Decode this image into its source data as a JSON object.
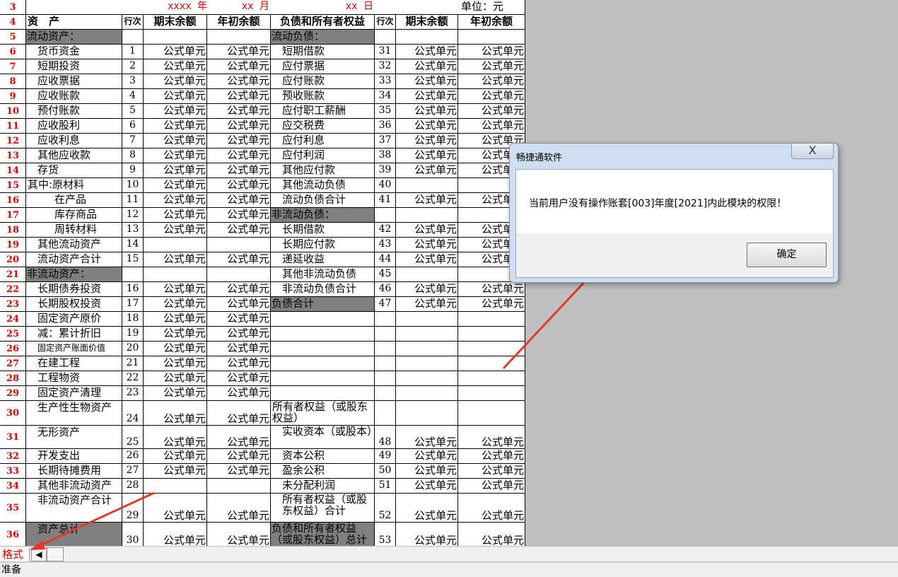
{
  "header": {
    "year": "xxxx 年",
    "month": "xx 月",
    "day": "xx 日",
    "unit": "单位：元"
  },
  "columns": {
    "assets": "资　产",
    "line_no": "行次",
    "end_balance": "期末余额",
    "begin_balance": "年初余额",
    "liab_equity": "负债和所有者权益",
    "line_no2": "行次",
    "end_balance2": "期末余额",
    "begin_balance2": "年初余额"
  },
  "row_numbers": [
    "3",
    "4",
    "5",
    "6",
    "7",
    "8",
    "9",
    "10",
    "11",
    "12",
    "13",
    "14",
    "15",
    "16",
    "17",
    "18",
    "19",
    "20",
    "21",
    "22",
    "23",
    "24",
    "25",
    "26",
    "27",
    "28",
    "29",
    "30",
    "31",
    "32",
    "33",
    "34",
    "35",
    "36"
  ],
  "rows": [
    {
      "l": "流动资产：",
      "lsec": true,
      "r": "流动负债：",
      "rsec": true
    },
    {
      "l": "货币资金",
      "ln": "1",
      "le": "公式单元",
      "lb": "公式单元",
      "r": "短期借款",
      "rn": "31",
      "re": "公式单元",
      "rb": "公式单元"
    },
    {
      "l": "短期投资",
      "ln": "2",
      "le": "公式单元",
      "lb": "公式单元",
      "r": "应付票据",
      "rn": "32",
      "re": "公式单元",
      "rb": "公式单元"
    },
    {
      "l": "应收票据",
      "ln": "3",
      "le": "公式单元",
      "lb": "公式单元",
      "r": "应付账款",
      "rn": "33",
      "re": "公式单元",
      "rb": "公式单元"
    },
    {
      "l": "应收账款",
      "ln": "4",
      "le": "公式单元",
      "lb": "公式单元",
      "r": "预收账款",
      "rn": "34",
      "re": "公式单元",
      "rb": "公式单元"
    },
    {
      "l": "预付账款",
      "ln": "5",
      "le": "公式单元",
      "lb": "公式单元",
      "r": "应付职工薪酬",
      "rn": "35",
      "re": "公式单元",
      "rb": "公式单元"
    },
    {
      "l": "应收股利",
      "ln": "6",
      "le": "公式单元",
      "lb": "公式单元",
      "r": "应交税费",
      "rn": "36",
      "re": "公式单元",
      "rb": "公式单元"
    },
    {
      "l": "应收利息",
      "ln": "7",
      "le": "公式单元",
      "lb": "公式单元",
      "r": "应付利息",
      "rn": "37",
      "re": "公式单元",
      "rb": "公式单元"
    },
    {
      "l": "其他应收款",
      "ln": "8",
      "le": "公式单元",
      "lb": "公式单元",
      "r": "应付利润",
      "rn": "38",
      "re": "公式单元",
      "rb": "公式单元"
    },
    {
      "l": "存货",
      "ln": "9",
      "le": "公式单元",
      "lb": "公式单元",
      "r": "其他应付款",
      "rn": "39",
      "re": "公式单元",
      "rb": "公式单元"
    },
    {
      "l": "其中:原材料",
      "lind": 0,
      "ln": "10",
      "le": "公式单元",
      "lb": "公式单元",
      "r": "其他流动负债",
      "rn": "40",
      "re": "",
      "rb": ""
    },
    {
      "l": "在产品",
      "lind": 3,
      "ln": "11",
      "le": "公式单元",
      "lb": "公式单元",
      "r": "流动负债合计",
      "rn": "41",
      "re": "公式单元",
      "rb": "公式单元"
    },
    {
      "l": "库存商品",
      "lind": 3,
      "ln": "12",
      "le": "公式单元",
      "lb": "公式单元",
      "r": "非流动负债：",
      "rsec": true
    },
    {
      "l": "周转材料",
      "lind": 3,
      "ln": "13",
      "le": "公式单元",
      "lb": "公式单元",
      "r": "长期借款",
      "rn": "42",
      "re": "公式单元",
      "rb": "公式单元"
    },
    {
      "l": "其他流动资产",
      "ln": "14",
      "le": "",
      "lb": "",
      "r": "长期应付款",
      "rn": "43",
      "re": "公式单元",
      "rb": "公式单元"
    },
    {
      "l": "流动资产合计",
      "ln": "15",
      "le": "公式单元",
      "lb": "公式单元",
      "r": "递延收益",
      "rn": "44",
      "re": "公式单元",
      "rb": "公式单元"
    },
    {
      "l": "非流动资产：",
      "lsec": true,
      "r": "其他非流动负债",
      "rn": "45",
      "re": "",
      "rb": ""
    },
    {
      "l": "长期债券投资",
      "ln": "16",
      "le": "公式单元",
      "lb": "公式单元",
      "r": "非流动负债合计",
      "rn": "46",
      "re": "公式单元",
      "rb": "公式单元"
    },
    {
      "l": "长期股权投资",
      "ln": "17",
      "le": "公式单元",
      "lb": "公式单元",
      "r": "负债合计",
      "rsecfull": true,
      "rn": "47",
      "re": "公式单元",
      "rb": "公式单元"
    },
    {
      "l": "固定资产原价",
      "ln": "18",
      "le": "公式单元",
      "lb": "公式单元",
      "r": ""
    },
    {
      "l": "减：累计折旧",
      "ln": "19",
      "le": "公式单元",
      "lb": "公式单元",
      "r": ""
    },
    {
      "l": "固定资产账面价值",
      "lsmall": true,
      "ln": "20",
      "le": "公式单元",
      "lb": "公式单元",
      "r": ""
    },
    {
      "l": "在建工程",
      "ln": "21",
      "le": "公式单元",
      "lb": "公式单元",
      "r": ""
    },
    {
      "l": "工程物资",
      "ln": "22",
      "le": "公式单元",
      "lb": "公式单元",
      "r": ""
    },
    {
      "l": "固定资产清理",
      "ln": "23",
      "le": "公式单元",
      "lb": "公式单元",
      "r": ""
    },
    {
      "l": "生产性生物资产",
      "ln": "24",
      "le": "公式单元",
      "lb": "公式单元",
      "r": "所有者权益（或股东权益）",
      "rwrap": true
    },
    {
      "l": "无形资产",
      "ln": "25",
      "le": "公式单元",
      "lb": "公式单元",
      "r": "实收资本（或股本）",
      "rwrap": true,
      "rn": "48",
      "re": "公式单元",
      "rb": "公式单元"
    },
    {
      "l": "开发支出",
      "ln": "26",
      "le": "公式单元",
      "lb": "公式单元",
      "r": "资本公积",
      "rn": "49",
      "re": "公式单元",
      "rb": "公式单元"
    },
    {
      "l": "长期待摊费用",
      "ln": "27",
      "le": "公式单元",
      "lb": "公式单元",
      "r": "盈余公积",
      "rn": "50",
      "re": "公式单元",
      "rb": "公式单元"
    },
    {
      "l": "其他非流动资产",
      "ln": "28",
      "le": "",
      "lb": "",
      "r": "未分配利润",
      "rn": "51",
      "re": "公式单元",
      "rb": "公式单元"
    },
    {
      "l": "非流动资产合计",
      "ln": "29",
      "le": "公式单元",
      "lb": "公式单元",
      "r": "所有者权益（或股东权益）合计",
      "rwrap": true,
      "rn": "52",
      "re": "公式单元",
      "rb": "公式单元"
    },
    {
      "l": "资产总计",
      "lsecfull": true,
      "ln": "30",
      "le": "公式单元",
      "lb": "公式单元",
      "r": "负债和所有者权益（或股东权益）总计",
      "rwrap": true,
      "rsecfull": true,
      "rn": "53",
      "re": "公式单元",
      "rb": "公式单元"
    }
  ],
  "sheet_tab": "格式",
  "status": "准备",
  "dialog": {
    "title": "畅捷通软件",
    "close": "X",
    "message": "当前用户没有操作账套[003]年度[2021]内此模块的权限！",
    "ok": "确定"
  },
  "colors": {
    "accent_red": "#e23a2a",
    "section_gray": "#808080",
    "header_red": "#cc0000"
  }
}
